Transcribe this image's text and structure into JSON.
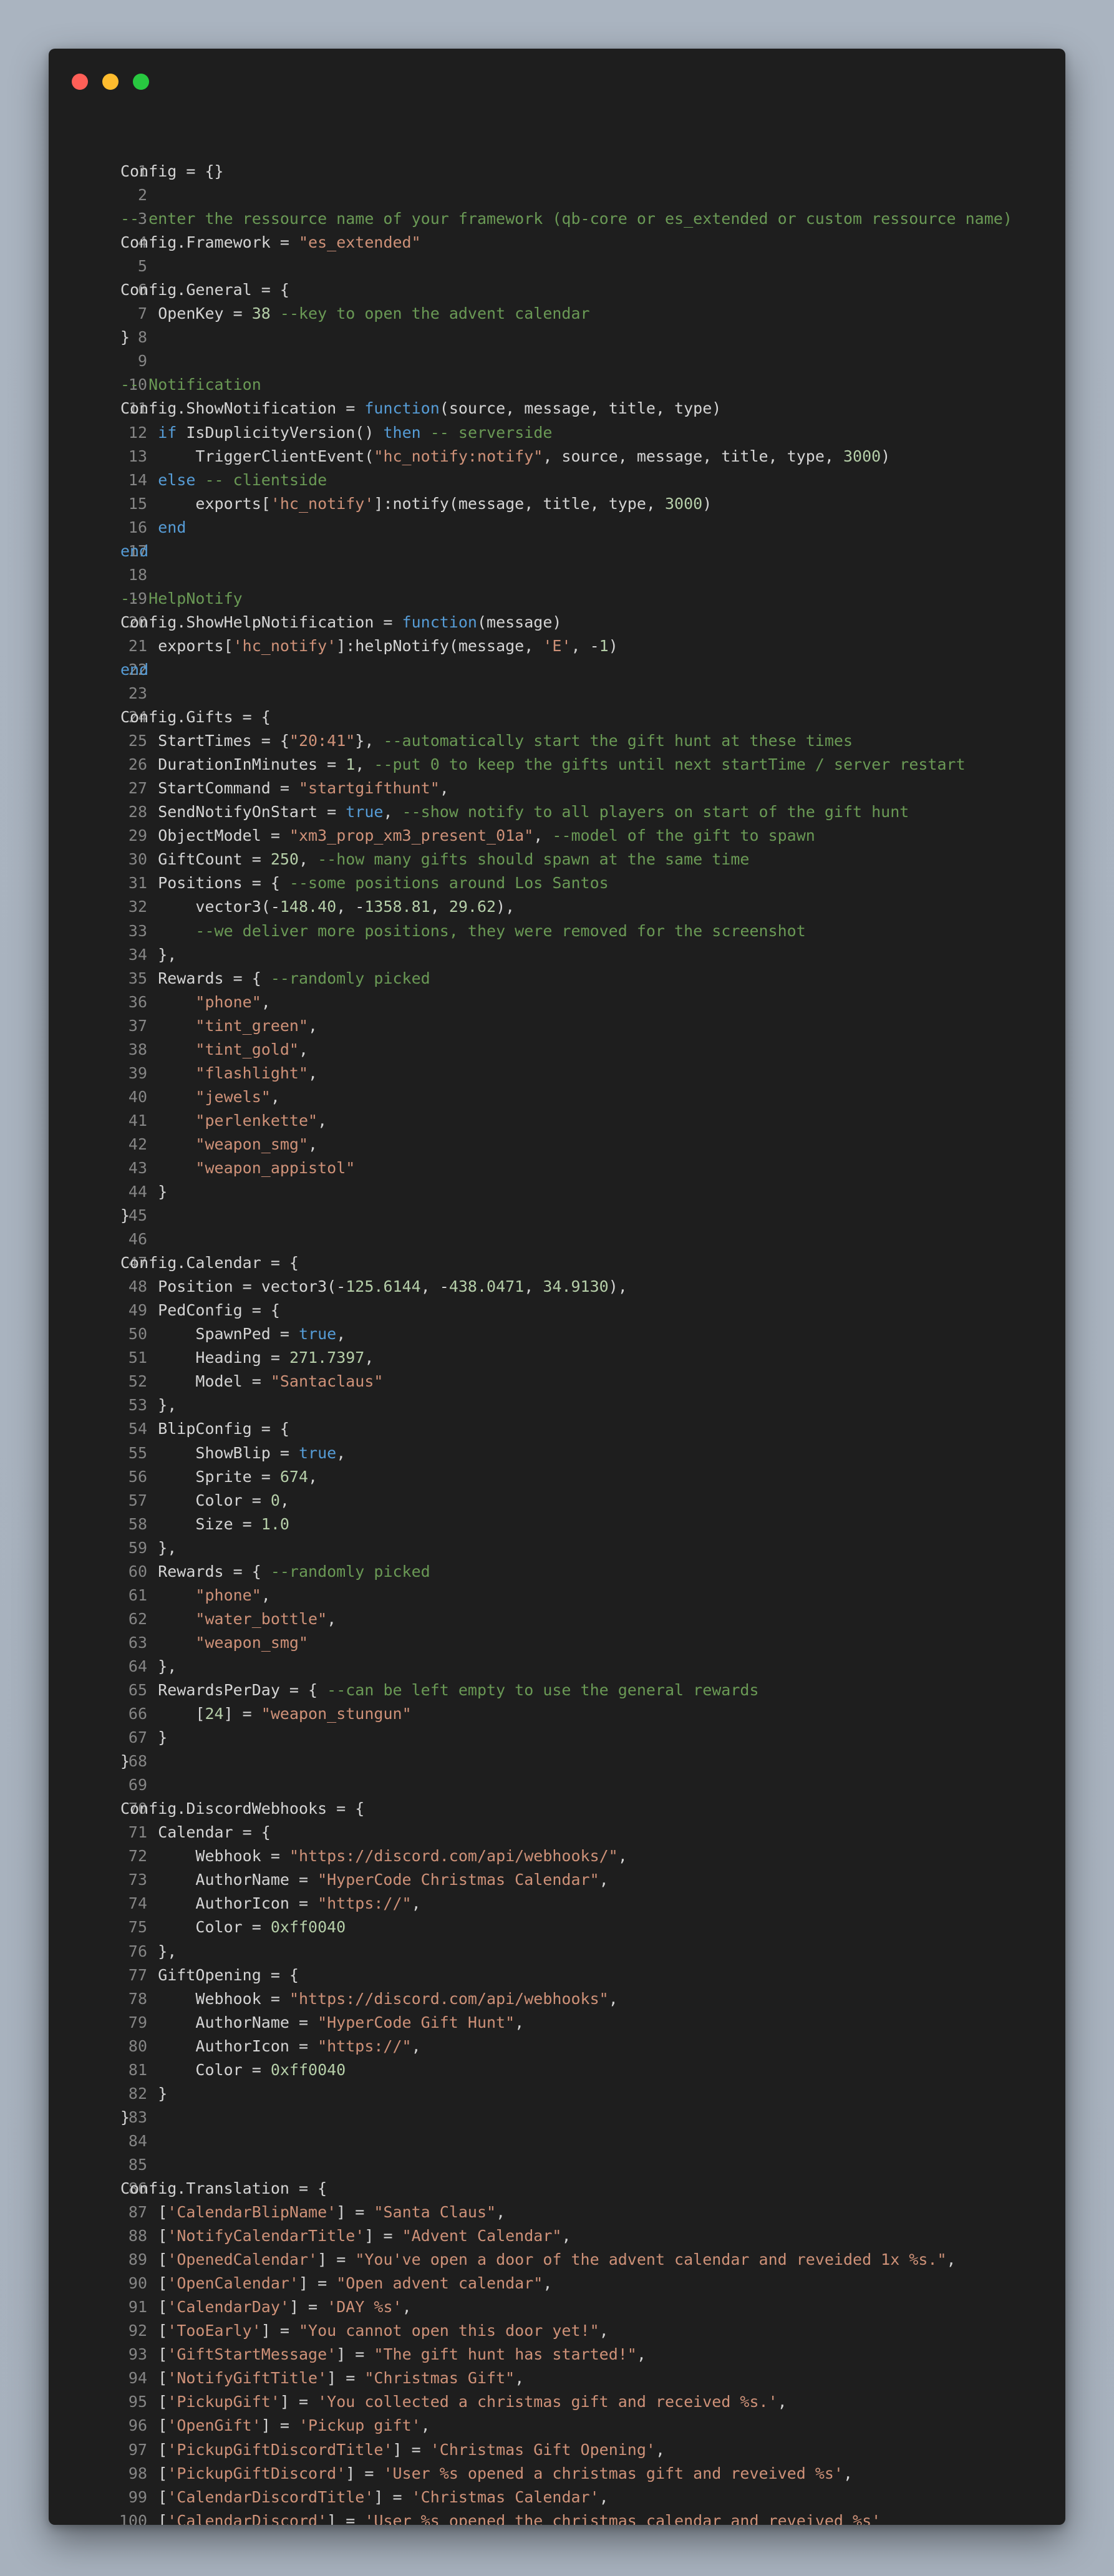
{
  "window": {
    "controls": [
      "close",
      "minimize",
      "maximize"
    ]
  },
  "colors": {
    "plain": "#d4d4d4",
    "string": "#ce9178",
    "number": "#b5cea8",
    "comment": "#6a9955",
    "keyword": "#569cd6",
    "line_number": "#858585",
    "background": "#1e1e1e"
  },
  "code": {
    "lines": [
      [
        [
          "p",
          "Config = {}"
        ]
      ],
      [],
      [
        [
          "c",
          "-- enter the ressource name of your framework (qb-core or es_extended or custom ressource name)"
        ]
      ],
      [
        [
          "p",
          "Config.Framework = "
        ],
        [
          "s",
          "\"es_extended\""
        ]
      ],
      [],
      [
        [
          "p",
          "Config.General = {"
        ]
      ],
      [
        [
          "p",
          "    OpenKey = "
        ],
        [
          "n",
          "38"
        ],
        [
          "p",
          " "
        ],
        [
          "c",
          "--key to open the advent calendar"
        ]
      ],
      [
        [
          "p",
          "}"
        ]
      ],
      [],
      [
        [
          "c",
          "-- Notification"
        ]
      ],
      [
        [
          "p",
          "Config.ShowNotification = "
        ],
        [
          "k",
          "function"
        ],
        [
          "p",
          "(source, message, title, type)"
        ]
      ],
      [
        [
          "p",
          "    "
        ],
        [
          "k",
          "if"
        ],
        [
          "p",
          " IsDuplicityVersion() "
        ],
        [
          "k",
          "then"
        ],
        [
          "p",
          " "
        ],
        [
          "c",
          "-- serverside"
        ]
      ],
      [
        [
          "p",
          "        TriggerClientEvent("
        ],
        [
          "s",
          "\"hc_notify:notify\""
        ],
        [
          "p",
          ", source, message, title, type, "
        ],
        [
          "n",
          "3000"
        ],
        [
          "p",
          ")"
        ]
      ],
      [
        [
          "p",
          "    "
        ],
        [
          "k",
          "else"
        ],
        [
          "p",
          " "
        ],
        [
          "c",
          "-- clientside"
        ]
      ],
      [
        [
          "p",
          "        exports["
        ],
        [
          "s",
          "'hc_notify'"
        ],
        [
          "p",
          "]:notify(message, title, type, "
        ],
        [
          "n",
          "3000"
        ],
        [
          "p",
          ")"
        ]
      ],
      [
        [
          "p",
          "    "
        ],
        [
          "k",
          "end"
        ]
      ],
      [
        [
          "k",
          "end"
        ]
      ],
      [],
      [
        [
          "c",
          "-- HelpNotify"
        ]
      ],
      [
        [
          "p",
          "Config.ShowHelpNotification = "
        ],
        [
          "k",
          "function"
        ],
        [
          "p",
          "(message)"
        ]
      ],
      [
        [
          "p",
          "    exports["
        ],
        [
          "s",
          "'hc_notify'"
        ],
        [
          "p",
          "]:helpNotify(message, "
        ],
        [
          "s",
          "'E'"
        ],
        [
          "p",
          ", -"
        ],
        [
          "n",
          "1"
        ],
        [
          "p",
          ")"
        ]
      ],
      [
        [
          "k",
          "end"
        ]
      ],
      [],
      [
        [
          "p",
          "Config.Gifts = {"
        ]
      ],
      [
        [
          "p",
          "    StartTimes = {"
        ],
        [
          "s",
          "\"20:41\""
        ],
        [
          "p",
          "}, "
        ],
        [
          "c",
          "--automatically start the gift hunt at these times"
        ]
      ],
      [
        [
          "p",
          "    DurationInMinutes = "
        ],
        [
          "n",
          "1"
        ],
        [
          "p",
          ", "
        ],
        [
          "c",
          "--put 0 to keep the gifts until next startTime / server restart"
        ]
      ],
      [
        [
          "p",
          "    StartCommand = "
        ],
        [
          "s",
          "\"startgifthunt\""
        ],
        [
          "p",
          ","
        ]
      ],
      [
        [
          "p",
          "    SendNotifyOnStart = "
        ],
        [
          "k",
          "true"
        ],
        [
          "p",
          ", "
        ],
        [
          "c",
          "--show notify to all players on start of the gift hunt"
        ]
      ],
      [
        [
          "p",
          "    ObjectModel = "
        ],
        [
          "s",
          "\"xm3_prop_xm3_present_01a\""
        ],
        [
          "p",
          ", "
        ],
        [
          "c",
          "--model of the gift to spawn"
        ]
      ],
      [
        [
          "p",
          "    GiftCount = "
        ],
        [
          "n",
          "250"
        ],
        [
          "p",
          ", "
        ],
        [
          "c",
          "--how many gifts should spawn at the same time"
        ]
      ],
      [
        [
          "p",
          "    Positions = { "
        ],
        [
          "c",
          "--some positions around Los Santos"
        ]
      ],
      [
        [
          "p",
          "        vector3(-"
        ],
        [
          "n",
          "148.40"
        ],
        [
          "p",
          ", -"
        ],
        [
          "n",
          "1358.81"
        ],
        [
          "p",
          ", "
        ],
        [
          "n",
          "29.62"
        ],
        [
          "p",
          "),"
        ]
      ],
      [
        [
          "p",
          "        "
        ],
        [
          "c",
          "--we deliver more positions, they were removed for the screenshot"
        ]
      ],
      [
        [
          "p",
          "    },"
        ]
      ],
      [
        [
          "p",
          "    Rewards = { "
        ],
        [
          "c",
          "--randomly picked"
        ]
      ],
      [
        [
          "p",
          "        "
        ],
        [
          "s",
          "\"phone\""
        ],
        [
          "p",
          ","
        ]
      ],
      [
        [
          "p",
          "        "
        ],
        [
          "s",
          "\"tint_green\""
        ],
        [
          "p",
          ","
        ]
      ],
      [
        [
          "p",
          "        "
        ],
        [
          "s",
          "\"tint_gold\""
        ],
        [
          "p",
          ","
        ]
      ],
      [
        [
          "p",
          "        "
        ],
        [
          "s",
          "\"flashlight\""
        ],
        [
          "p",
          ","
        ]
      ],
      [
        [
          "p",
          "        "
        ],
        [
          "s",
          "\"jewels\""
        ],
        [
          "p",
          ","
        ]
      ],
      [
        [
          "p",
          "        "
        ],
        [
          "s",
          "\"perlenkette\""
        ],
        [
          "p",
          ","
        ]
      ],
      [
        [
          "p",
          "        "
        ],
        [
          "s",
          "\"weapon_smg\""
        ],
        [
          "p",
          ","
        ]
      ],
      [
        [
          "p",
          "        "
        ],
        [
          "s",
          "\"weapon_appistol\""
        ]
      ],
      [
        [
          "p",
          "    }"
        ]
      ],
      [
        [
          "p",
          "}"
        ]
      ],
      [],
      [
        [
          "p",
          "Config.Calendar = {"
        ]
      ],
      [
        [
          "p",
          "    Position = vector3(-"
        ],
        [
          "n",
          "125.6144"
        ],
        [
          "p",
          ", -"
        ],
        [
          "n",
          "438.0471"
        ],
        [
          "p",
          ", "
        ],
        [
          "n",
          "34.9130"
        ],
        [
          "p",
          "),"
        ]
      ],
      [
        [
          "p",
          "    PedConfig = {"
        ]
      ],
      [
        [
          "p",
          "        SpawnPed = "
        ],
        [
          "k",
          "true"
        ],
        [
          "p",
          ","
        ]
      ],
      [
        [
          "p",
          "        Heading = "
        ],
        [
          "n",
          "271.7397"
        ],
        [
          "p",
          ","
        ]
      ],
      [
        [
          "p",
          "        Model = "
        ],
        [
          "s",
          "\"Santaclaus\""
        ]
      ],
      [
        [
          "p",
          "    },"
        ]
      ],
      [
        [
          "p",
          "    BlipConfig = {"
        ]
      ],
      [
        [
          "p",
          "        ShowBlip = "
        ],
        [
          "k",
          "true"
        ],
        [
          "p",
          ","
        ]
      ],
      [
        [
          "p",
          "        Sprite = "
        ],
        [
          "n",
          "674"
        ],
        [
          "p",
          ","
        ]
      ],
      [
        [
          "p",
          "        Color = "
        ],
        [
          "n",
          "0"
        ],
        [
          "p",
          ","
        ]
      ],
      [
        [
          "p",
          "        Size = "
        ],
        [
          "n",
          "1.0"
        ]
      ],
      [
        [
          "p",
          "    },"
        ]
      ],
      [
        [
          "p",
          "    Rewards = { "
        ],
        [
          "c",
          "--randomly picked"
        ]
      ],
      [
        [
          "p",
          "        "
        ],
        [
          "s",
          "\"phone\""
        ],
        [
          "p",
          ","
        ]
      ],
      [
        [
          "p",
          "        "
        ],
        [
          "s",
          "\"water_bottle\""
        ],
        [
          "p",
          ","
        ]
      ],
      [
        [
          "p",
          "        "
        ],
        [
          "s",
          "\"weapon_smg\""
        ]
      ],
      [
        [
          "p",
          "    },"
        ]
      ],
      [
        [
          "p",
          "    RewardsPerDay = { "
        ],
        [
          "c",
          "--can be left empty to use the general rewards"
        ]
      ],
      [
        [
          "p",
          "        ["
        ],
        [
          "n",
          "24"
        ],
        [
          "p",
          "] = "
        ],
        [
          "s",
          "\"weapon_stungun\""
        ]
      ],
      [
        [
          "p",
          "    }"
        ]
      ],
      [
        [
          "p",
          "}"
        ]
      ],
      [],
      [
        [
          "p",
          "Config.DiscordWebhooks = {"
        ]
      ],
      [
        [
          "p",
          "    Calendar = {"
        ]
      ],
      [
        [
          "p",
          "        Webhook = "
        ],
        [
          "s",
          "\"https://discord.com/api/webhooks/\""
        ],
        [
          "p",
          ","
        ]
      ],
      [
        [
          "p",
          "        AuthorName = "
        ],
        [
          "s",
          "\"HyperCode Christmas Calendar\""
        ],
        [
          "p",
          ","
        ]
      ],
      [
        [
          "p",
          "        AuthorIcon = "
        ],
        [
          "s",
          "\"https://\""
        ],
        [
          "p",
          ","
        ]
      ],
      [
        [
          "p",
          "        Color = "
        ],
        [
          "n",
          "0xff0040"
        ]
      ],
      [
        [
          "p",
          "    },"
        ]
      ],
      [
        [
          "p",
          "    GiftOpening = {"
        ]
      ],
      [
        [
          "p",
          "        Webhook = "
        ],
        [
          "s",
          "\"https://discord.com/api/webhooks\""
        ],
        [
          "p",
          ","
        ]
      ],
      [
        [
          "p",
          "        AuthorName = "
        ],
        [
          "s",
          "\"HyperCode Gift Hunt\""
        ],
        [
          "p",
          ","
        ]
      ],
      [
        [
          "p",
          "        AuthorIcon = "
        ],
        [
          "s",
          "\"https://\""
        ],
        [
          "p",
          ","
        ]
      ],
      [
        [
          "p",
          "        Color = "
        ],
        [
          "n",
          "0xff0040"
        ]
      ],
      [
        [
          "p",
          "    }"
        ]
      ],
      [
        [
          "p",
          "}"
        ]
      ],
      [],
      [],
      [
        [
          "p",
          "Config.Translation = {"
        ]
      ],
      [
        [
          "p",
          "    ["
        ],
        [
          "s",
          "'CalendarBlipName'"
        ],
        [
          "p",
          "] = "
        ],
        [
          "s",
          "\"Santa Claus\""
        ],
        [
          "p",
          ","
        ]
      ],
      [
        [
          "p",
          "    ["
        ],
        [
          "s",
          "'NotifyCalendarTitle'"
        ],
        [
          "p",
          "] = "
        ],
        [
          "s",
          "\"Advent Calendar\""
        ],
        [
          "p",
          ","
        ]
      ],
      [
        [
          "p",
          "    ["
        ],
        [
          "s",
          "'OpenedCalendar'"
        ],
        [
          "p",
          "] = "
        ],
        [
          "s",
          "\"You've open a door of the advent calendar and reveided 1x %s.\""
        ],
        [
          "p",
          ","
        ]
      ],
      [
        [
          "p",
          "    ["
        ],
        [
          "s",
          "'OpenCalendar'"
        ],
        [
          "p",
          "] = "
        ],
        [
          "s",
          "\"Open advent calendar\""
        ],
        [
          "p",
          ","
        ]
      ],
      [
        [
          "p",
          "    ["
        ],
        [
          "s",
          "'CalendarDay'"
        ],
        [
          "p",
          "] = "
        ],
        [
          "s",
          "'DAY %s'"
        ],
        [
          "p",
          ","
        ]
      ],
      [
        [
          "p",
          "    ["
        ],
        [
          "s",
          "'TooEarly'"
        ],
        [
          "p",
          "] = "
        ],
        [
          "s",
          "\"You cannot open this door yet!\""
        ],
        [
          "p",
          ","
        ]
      ],
      [
        [
          "p",
          "    ["
        ],
        [
          "s",
          "'GiftStartMessage'"
        ],
        [
          "p",
          "] = "
        ],
        [
          "s",
          "\"The gift hunt has started!\""
        ],
        [
          "p",
          ","
        ]
      ],
      [
        [
          "p",
          "    ["
        ],
        [
          "s",
          "'NotifyGiftTitle'"
        ],
        [
          "p",
          "] = "
        ],
        [
          "s",
          "\"Christmas Gift\""
        ],
        [
          "p",
          ","
        ]
      ],
      [
        [
          "p",
          "    ["
        ],
        [
          "s",
          "'PickupGift'"
        ],
        [
          "p",
          "] = "
        ],
        [
          "s",
          "'You collected a christmas gift and received %s.'"
        ],
        [
          "p",
          ","
        ]
      ],
      [
        [
          "p",
          "    ["
        ],
        [
          "s",
          "'OpenGift'"
        ],
        [
          "p",
          "] = "
        ],
        [
          "s",
          "'Pickup gift'"
        ],
        [
          "p",
          ","
        ]
      ],
      [
        [
          "p",
          "    ["
        ],
        [
          "s",
          "'PickupGiftDiscordTitle'"
        ],
        [
          "p",
          "] = "
        ],
        [
          "s",
          "'Christmas Gift Opening'"
        ],
        [
          "p",
          ","
        ]
      ],
      [
        [
          "p",
          "    ["
        ],
        [
          "s",
          "'PickupGiftDiscord'"
        ],
        [
          "p",
          "] = "
        ],
        [
          "s",
          "'User %s opened a christmas gift and reveived %s'"
        ],
        [
          "p",
          ","
        ]
      ],
      [
        [
          "p",
          "    ["
        ],
        [
          "s",
          "'CalendarDiscordTitle'"
        ],
        [
          "p",
          "] = "
        ],
        [
          "s",
          "'Christmas Calendar'"
        ],
        [
          "p",
          ","
        ]
      ],
      [
        [
          "p",
          "    ["
        ],
        [
          "s",
          "'CalendarDiscord'"
        ],
        [
          "p",
          "] = "
        ],
        [
          "s",
          "'User %s opened the christmas calendar and reveived %s'"
        ]
      ],
      [
        [
          "p",
          "}"
        ]
      ]
    ]
  }
}
